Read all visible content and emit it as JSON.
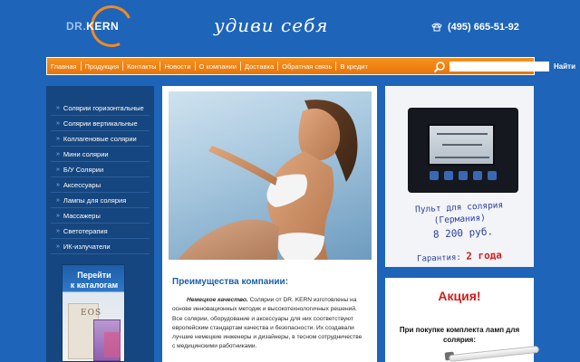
{
  "header": {
    "logo_prefix": "DR.",
    "logo_name": "KERN",
    "slogan": "удиви себя",
    "phone": "(495) 665-51-92"
  },
  "nav": {
    "items": [
      "Главная",
      "Продукция",
      "Контакты",
      "Новости",
      "О компании",
      "Доставка",
      "Обратная связь",
      "В кредит"
    ],
    "search_placeholder": "",
    "search_button": "Найти"
  },
  "sidebar": {
    "items": [
      "Солярии горизонтальные",
      "Солярии вертикальные",
      "Коллагеновые солярии",
      "Мини солярии",
      "Б/У Солярии",
      "Аксессуары",
      "Лампы для солярия",
      "Массажеры",
      "Светотерапия",
      "ИК-излучатели"
    ],
    "catalog_line1": "Перейти",
    "catalog_line2": "к каталогам",
    "catalog_brand": "EOS"
  },
  "main": {
    "heading": "Преимущества компании:",
    "text_emphasis": "Немецкое качество.",
    "text_body": "Солярии от DR. KERN изготовлены на основе инновационных методик и высокотехнологичных решений. Все солярии, оборудование и аксессуары для них соответствуют европейским стандартам качества и безопасности. Их создавали лучшие немецкие инженеры и дизайнеры, в тесном сотрудничестве с медицинскими работниками."
  },
  "ad": {
    "title_line1": "Пульт для солярия",
    "title_line2": "(Германия)",
    "price": "8 200 руб.",
    "warranty_label": "Гарантия:",
    "warranty_value": "2 года"
  },
  "promo": {
    "title": "Акция!",
    "text": "При покупке комплекта ламп для солярия:"
  },
  "colors": {
    "background": "#1e64b9",
    "nav_orange": "#f7931e",
    "accent_blue": "#1d5fa8",
    "promo_red": "#d21d1d"
  }
}
